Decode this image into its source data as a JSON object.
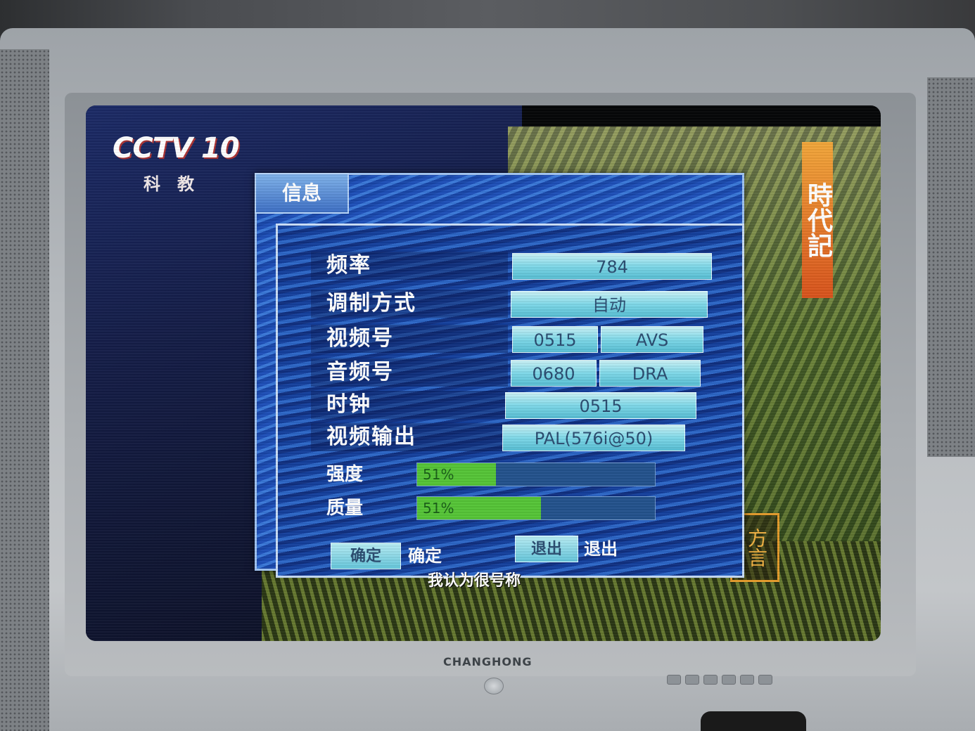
{
  "screen": {
    "channel_logo": "CCTV 10",
    "channel_sub": "科教",
    "program_banner": "時代記",
    "corner_stamp": "方言",
    "subtitle": "我认为很号称"
  },
  "dialog": {
    "title": "信息",
    "rows": [
      {
        "label": "频率",
        "value": "784"
      },
      {
        "label": "调制方式",
        "value": "自动"
      },
      {
        "label": "视频号",
        "value": "0515",
        "value2": "AVS"
      },
      {
        "label": "音频号",
        "value": "0680",
        "value2": "DRA"
      },
      {
        "label": "时钟",
        "value": "0515"
      },
      {
        "label": "视频输出",
        "value": "PAL(576i@50)"
      }
    ],
    "signal": [
      {
        "label": "强度",
        "percent_text": "51%",
        "level": 0.33
      },
      {
        "label": "质量",
        "percent_text": "51%",
        "level": 0.52
      }
    ],
    "buttons": {
      "ok_key": "确定",
      "ok_caption": "确定",
      "exit_key": "退出",
      "exit_caption": "退出"
    }
  },
  "tv": {
    "brand": "CHANGHONG"
  },
  "colors": {
    "dialog_blue": "#1d4fb8",
    "field_cyan": "#7ed8e8",
    "bar_green": "#55c437"
  }
}
